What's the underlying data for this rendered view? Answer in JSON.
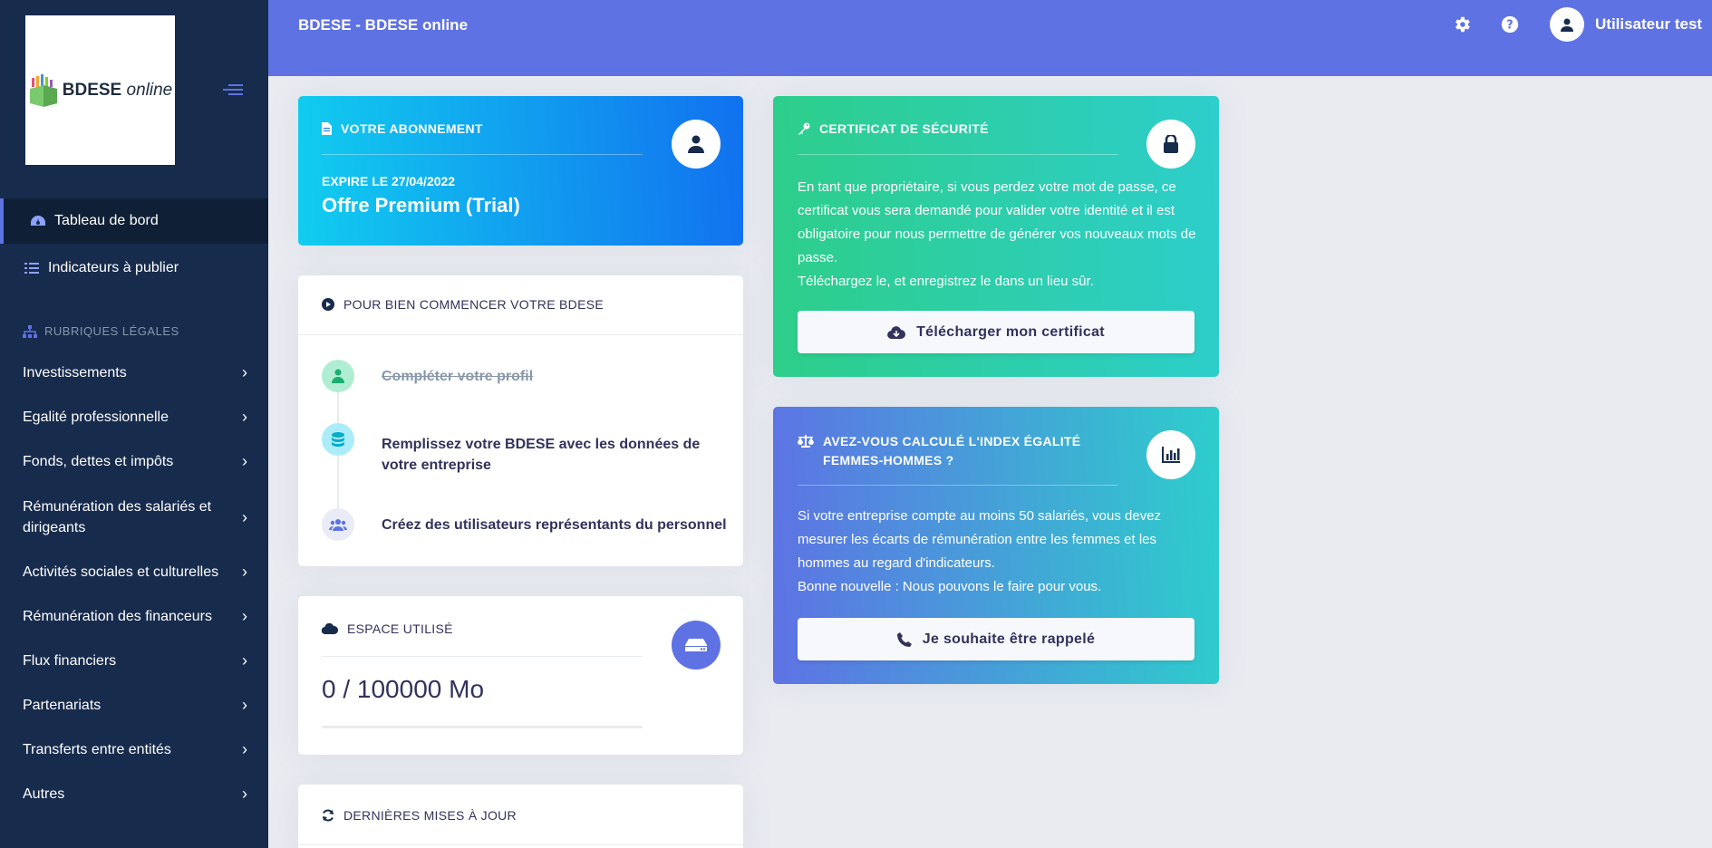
{
  "colors": {
    "sidebar_bg": "#172b4d",
    "topbar_bg": "#5e72e4",
    "accent": "#5e72e4",
    "subscription_gradient": [
      "#11cdef",
      "#1171ef"
    ],
    "security_gradient": [
      "#2dce89",
      "#2dcecc"
    ],
    "index_gradient": [
      "#5e72e4",
      "#2dcecc"
    ]
  },
  "logo": {
    "brand": "BDESE",
    "suffix": "online"
  },
  "topbar": {
    "title": "BDESE - BDESE online",
    "user_name": "Utilisateur test"
  },
  "sidebar": {
    "dashboard_label": "Tableau de bord",
    "indicators_label": "Indicateurs à publier",
    "section_label": "Rubriques légales",
    "items": [
      "Investissements",
      "Egalité professionnelle",
      "Fonds, dettes et impôts",
      "Rémunération des salariés et dirigeants",
      "Activités sociales et culturelles",
      "Rémunération des financeurs",
      "Flux financiers",
      "Partenariats",
      "Transferts entre entités",
      "Autres"
    ]
  },
  "subscription": {
    "heading": "Votre abonnement",
    "expires": "EXPIRE LE 27/04/2022",
    "offer": "Offre Premium (Trial)"
  },
  "getting_started": {
    "heading": "Pour bien commencer votre BDESE",
    "steps": [
      "Compléter votre profil",
      "Remplissez votre BDESE avec les données de votre entreprise",
      "Créez des utilisateurs représentants du personnel"
    ]
  },
  "storage": {
    "heading": "Espace utilisé",
    "value": "0 / 100000 Mo",
    "used_fraction": 0
  },
  "updates": {
    "heading": "Dernières mises à jour"
  },
  "security": {
    "heading": "Certificat de sécurité",
    "body": "En tant que propriétaire, si vous perdez votre mot de passe, ce certificat vous sera demandé pour valider votre identité et il est obligatoire pour nous permettre de générer vos nouveaux mots de passe.",
    "body2": "Téléchargez le, et enregistrez le dans un lieu sûr.",
    "button": "Télécharger mon certificat"
  },
  "index": {
    "heading": "Avez-vous calculé l'index égalité femmes-hommes ?",
    "body": "Si votre entreprise compte au moins 50 salariés, vous devez mesurer les écarts de rémunération entre les femmes et les hommes au regard d'indicateurs.",
    "body2": "Bonne nouvelle : Nous pouvons le faire pour vous.",
    "button": "Je souhaite être rappelé"
  }
}
